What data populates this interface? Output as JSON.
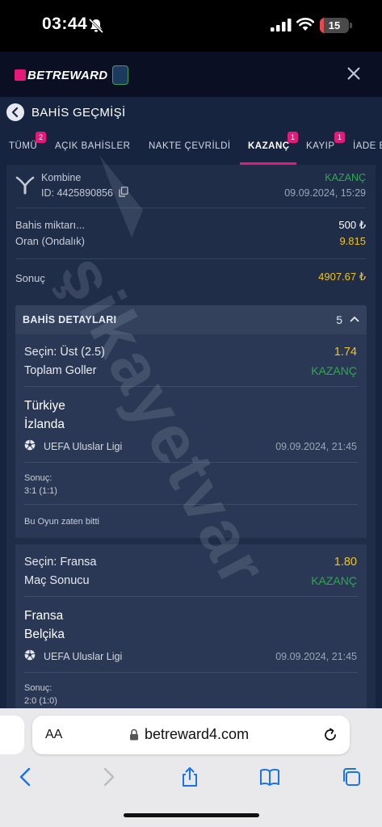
{
  "status_bar": {
    "time": "03:44",
    "battery": "15",
    "battery_level": 0.15
  },
  "app_header": {
    "brand": "BETREWARD"
  },
  "page": {
    "title": "BAHİS GEÇMİŞİ"
  },
  "tabs": [
    {
      "label": "TÜMÜ",
      "badge": "2"
    },
    {
      "label": "AÇIK BAHİSLER",
      "badge": ""
    },
    {
      "label": "NAKTE ÇEVRİLDİ",
      "badge": ""
    },
    {
      "label": "KAZANÇ",
      "badge": "1",
      "active": true
    },
    {
      "label": "KAYIP",
      "badge": "1"
    },
    {
      "label": "İADE E",
      "badge": ""
    }
  ],
  "bet": {
    "type": "Kombine",
    "id": "ID: 4425890856",
    "status": "KAZANÇ",
    "date": "09.09.2024, 15:29",
    "stake_label": "Bahis miktarı...",
    "stake_value": "500 ₺",
    "odds_label": "Oran (Ondalık)",
    "odds_value": "9.815",
    "result_label": "Sonuç",
    "result_value": "4907.67 ₺"
  },
  "details": {
    "title": "BAHİS DETAYLARI",
    "count": "5",
    "selections": [
      {
        "pick_label": "Seçin:",
        "pick": "Üst (2.5)",
        "odds": "1.74",
        "market": "Toplam Goller",
        "status": "KAZANÇ",
        "home": "Türkiye",
        "away": "İzlanda",
        "league": "UEFA Uluslar Ligi",
        "date": "09.09.2024, 21:45",
        "score_label": "Sonuç:",
        "score": "3:1 (1:1)",
        "note": "Bu Oyun zaten bitti"
      },
      {
        "pick_label": "Seçin:",
        "pick": "Fransa",
        "odds": "1.80",
        "market": "Maç Sonucu",
        "status": "KAZANÇ",
        "home": "Fransa",
        "away": "Belçika",
        "league": "UEFA Uluslar Ligi",
        "date": "09.09.2024, 21:45",
        "score_label": "Sonuç:",
        "score": "2:0 (1:0)"
      }
    ]
  },
  "watermark": "şikayetvar",
  "browser": {
    "aa": "AA",
    "url": "betreward4.com"
  },
  "colors": {
    "accent": "#e6197a",
    "win": "#2fa84f",
    "odds": "#f0c419",
    "background": "#17243f"
  }
}
